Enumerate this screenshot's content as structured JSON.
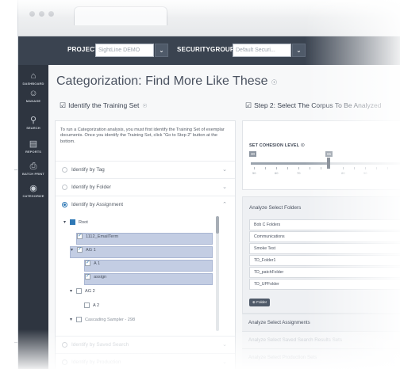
{
  "topbar": {
    "project_label": "PROJECT:",
    "project_value": "SightLine DEMO",
    "securitygroup_label": "SECURITYGROUP:",
    "securitygroup_value": "Default Securi..."
  },
  "sidenav": {
    "items": [
      {
        "label": "DASHBOARD",
        "icon": "home-icon"
      },
      {
        "label": "MANAGE",
        "icon": "people-icon"
      },
      {
        "label": "SEARCH",
        "icon": "search-icon"
      },
      {
        "label": "REPORTS",
        "icon": "bar-chart-icon"
      },
      {
        "label": "BATCH PRINT",
        "icon": "printer-icon"
      },
      {
        "label": "CATEGORIZE",
        "icon": "eye-icon"
      }
    ]
  },
  "page": {
    "title": "Categorization: Find More Like These",
    "step1": "Identify the Training Set",
    "step2": "Step 2: Select The Corpus To Be Analyzed",
    "intro": "To run a Categorization analysis, you must first identify the Training Set of exemplar documents. Once you identify the Training Set, click \"Go to Step 2\" button at the bottom."
  },
  "accordion": [
    {
      "label": "Identify by Tag",
      "selected": false
    },
    {
      "label": "Identify by Folder",
      "selected": false
    },
    {
      "label": "Identify by Assignment",
      "selected": true
    },
    {
      "label": "Identify by Saved Search",
      "selected": false
    },
    {
      "label": "Identify by Production",
      "selected": false
    }
  ],
  "tree": [
    {
      "label": "Root",
      "level": 0,
      "state": "partial",
      "expander": "▾"
    },
    {
      "label": "1112_EmailTerm",
      "level": 1,
      "state": "checked",
      "expander": "",
      "selected": true
    },
    {
      "label": "AG 1",
      "level": 1,
      "state": "checked",
      "expander": "▾",
      "selected": true
    },
    {
      "label": "A 1",
      "level": 2,
      "state": "checked",
      "expander": "",
      "selected": true
    },
    {
      "label": "assign",
      "level": 2,
      "state": "checked",
      "expander": "",
      "selected": true
    },
    {
      "label": "AG 2",
      "level": 1,
      "state": "empty",
      "expander": "▾",
      "selected": false
    },
    {
      "label": "A 2",
      "level": 2,
      "state": "empty",
      "expander": "",
      "selected": false
    },
    {
      "label": "Cascading Sampler - 298",
      "level": 1,
      "state": "empty",
      "expander": "▾",
      "selected": false
    }
  ],
  "cohesion": {
    "title": "SET COHESION LEVEL",
    "bubble_low": "30",
    "bubble_high": "65",
    "tick_labels": [
      "50",
      "60",
      "70",
      "80",
      "90"
    ]
  },
  "folders": {
    "title": "Analyze Select Folders",
    "items": [
      "Bob C Folders",
      "Communications",
      "Smoke Test",
      "TD_Folder1",
      "TD_patchFolder",
      "TD_UPFolder"
    ],
    "button": "Folder"
  },
  "right_sections": [
    {
      "label": "Analyze Select Assignments",
      "faded": false
    },
    {
      "label": "Analyze Select Saved Search Results Sets",
      "faded": true
    },
    {
      "label": "Analyze Select Production Sets",
      "faded": true
    }
  ],
  "colors": {
    "accent": "#2f78b5",
    "topbar": "#3a4350",
    "sidenav": "#2e3540"
  }
}
